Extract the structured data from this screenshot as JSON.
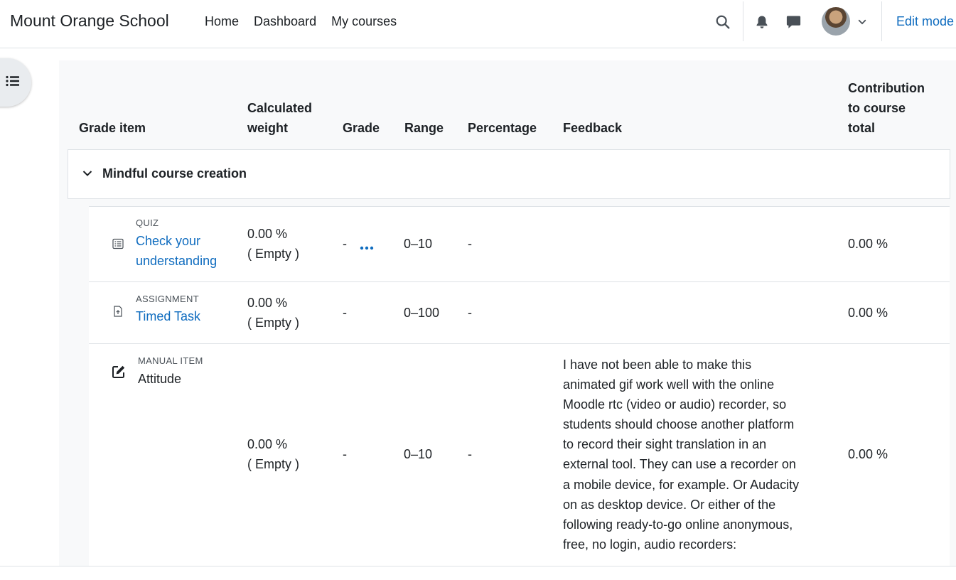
{
  "site": {
    "name": "Mount Orange School"
  },
  "nav": {
    "links": [
      "Home",
      "Dashboard",
      "My courses"
    ],
    "edit_mode_label": "Edit mode"
  },
  "icons": {
    "search": "search-icon",
    "notifications": "bell-icon",
    "messages": "chat-icon",
    "user_menu": "chevron-down-icon",
    "drawer": "list-icon"
  },
  "colors": {
    "link": "#0f6cbf",
    "text": "#1d2125",
    "muted": "#495057",
    "background": "#f8f9fa"
  },
  "table": {
    "headers": {
      "grade_item": "Grade item",
      "weight_line1": "Calculated",
      "weight_line2": "weight",
      "grade": "Grade",
      "range": "Range",
      "percentage": "Percentage",
      "feedback": "Feedback",
      "contribution_line1": "Contribution",
      "contribution_line2": "to course",
      "contribution_line3": "total"
    },
    "category": {
      "title": "Mindful course creation"
    },
    "rows": [
      {
        "type": "QUIZ",
        "name_line1": "Check your",
        "name_line2": "understanding",
        "weight": "0.00 %",
        "weight_note": "( Empty )",
        "grade": "-",
        "range": "0–10",
        "percentage": "-",
        "feedback": "",
        "contribution": "0.00 %"
      },
      {
        "type": "ASSIGNMENT",
        "name_line1": "Timed Task",
        "weight": "0.00 %",
        "weight_note": "( Empty )",
        "grade": "-",
        "range": "0–100",
        "percentage": "-",
        "feedback": "",
        "contribution": "0.00 %"
      },
      {
        "type": "MANUAL ITEM",
        "name_line1": "Attitude",
        "weight": "0.00 %",
        "weight_note": "( Empty )",
        "grade": "-",
        "range": "0–10",
        "percentage": "-",
        "feedback_lines": [
          "I have not been able to make this",
          "animated gif work well with the online",
          "Moodle rtc (video or audio) recorder, so",
          "students should choose another platform",
          "to record their sight translation in an",
          "external tool. They can use a recorder on",
          "a mobile device, for example. Or Audacity",
          "on as desktop device. Or either of the",
          "following ready-to-go online anonymous,",
          "free, no login, audio recorders:"
        ],
        "contribution": "0.00 %"
      }
    ]
  }
}
